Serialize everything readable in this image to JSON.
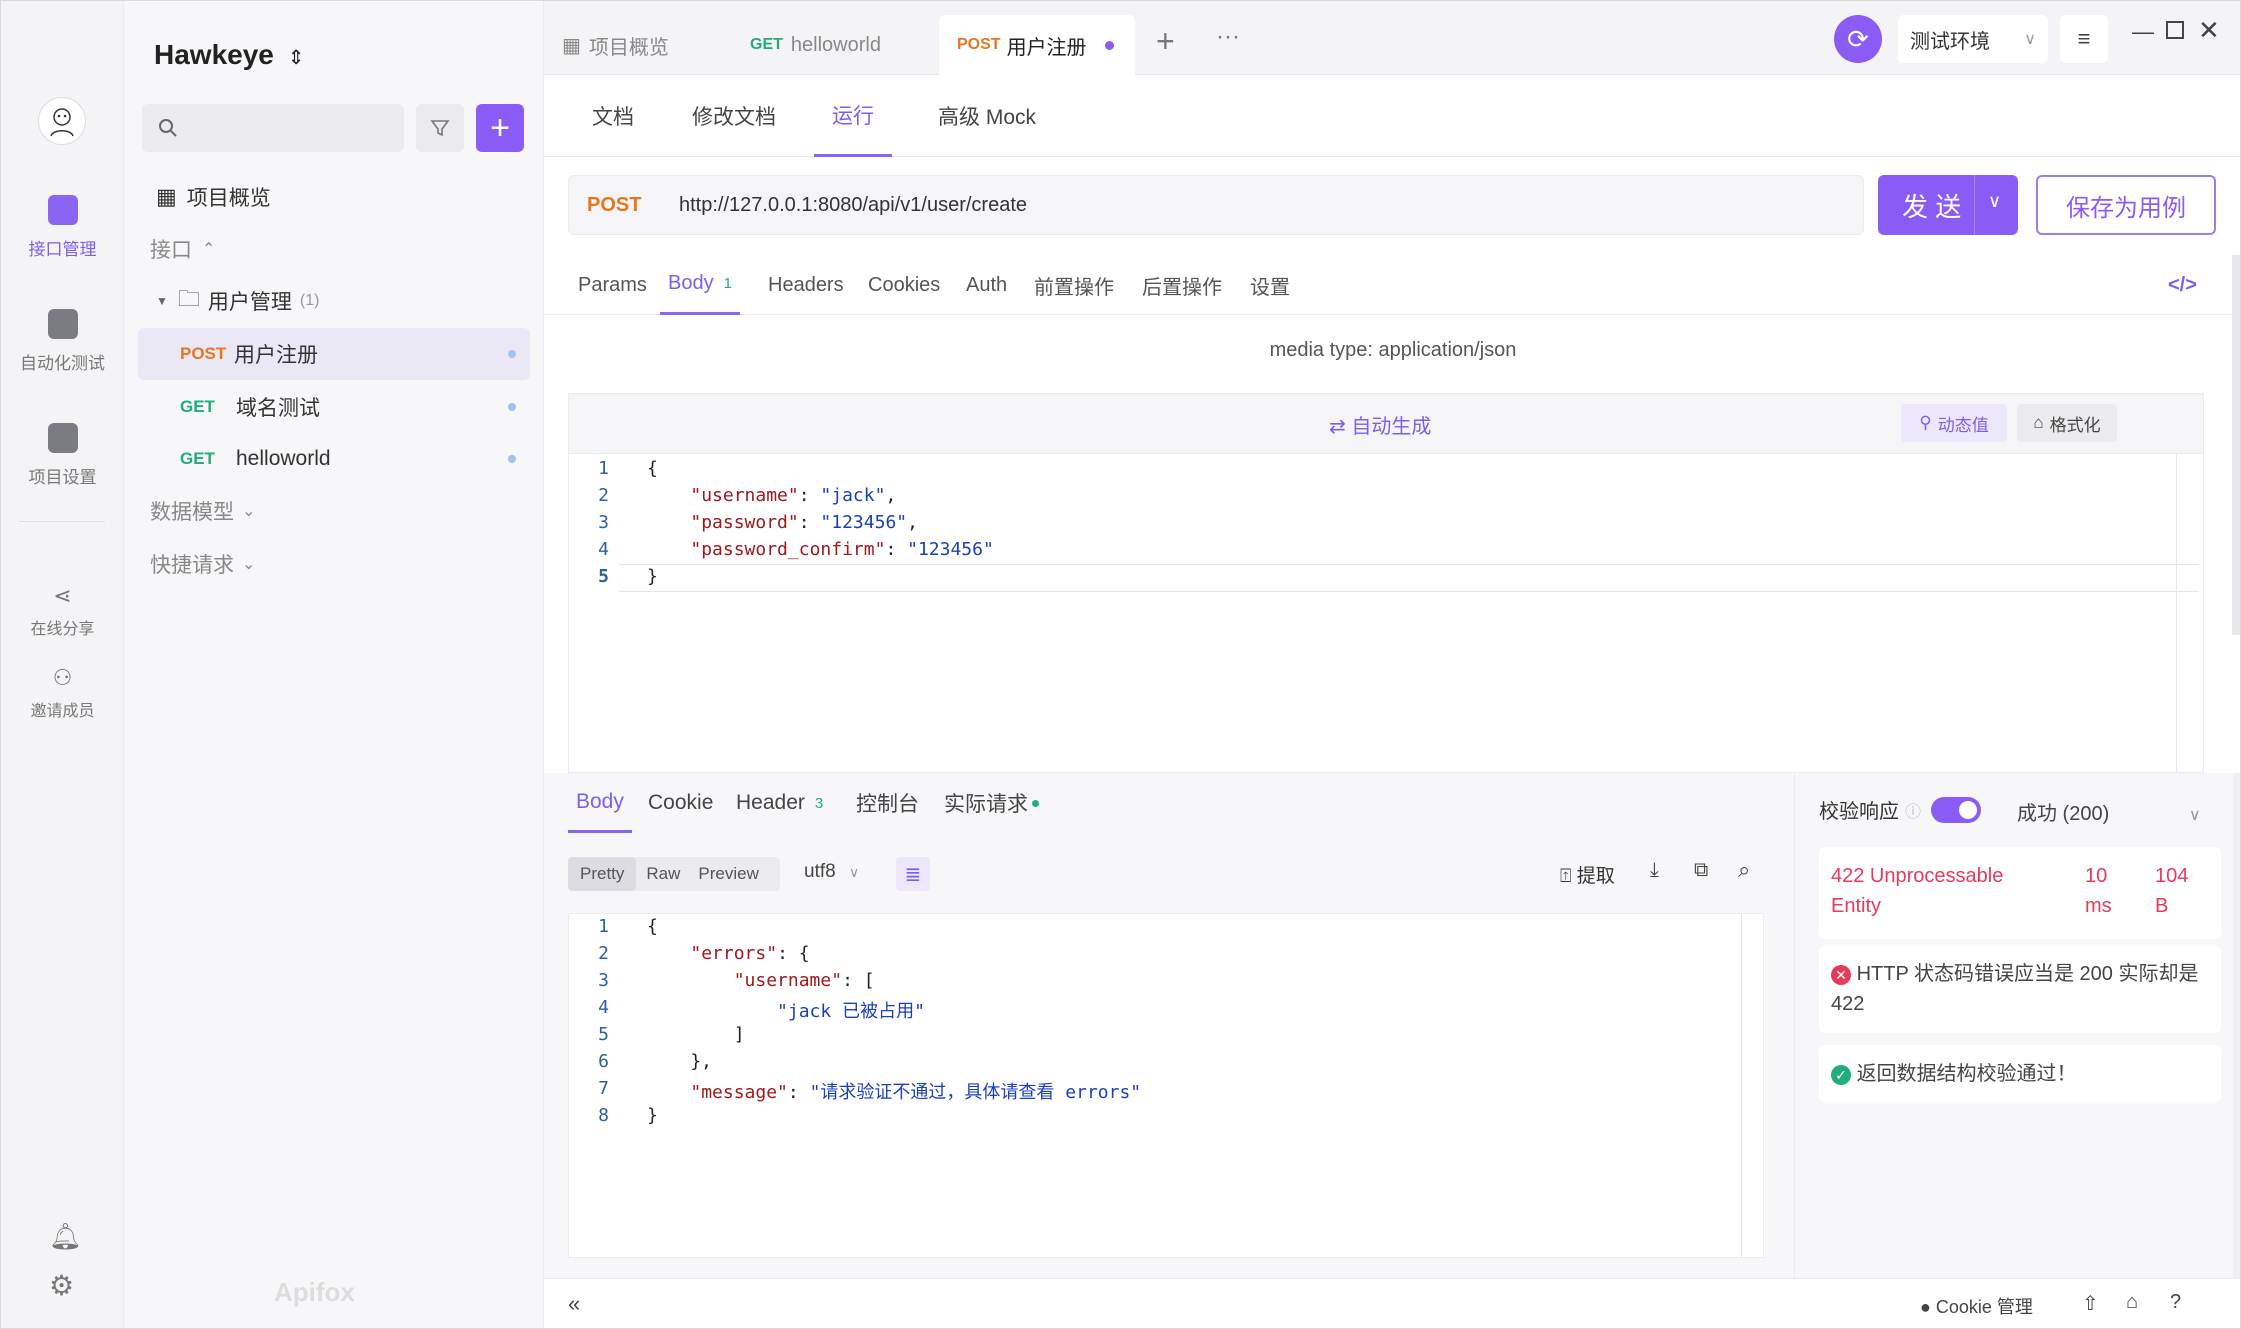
{
  "rail": {
    "items": [
      {
        "label": "接口管理"
      },
      {
        "label": "自动化测试"
      },
      {
        "label": "项目设置"
      },
      {
        "label": "在线分享"
      },
      {
        "label": "邀请成员"
      }
    ]
  },
  "sidebar": {
    "project_name": "Hawkeye",
    "overview": "项目概览",
    "api_section": "接口",
    "folder_name": "用户管理",
    "folder_count": "(1)",
    "items": [
      {
        "method": "POST",
        "name": "用户注册"
      },
      {
        "method": "GET",
        "name": "域名测试"
      },
      {
        "method": "GET",
        "name": "helloworld"
      }
    ],
    "data_models": "数据模型",
    "quick_requests": "快捷请求",
    "brand": "Apifox"
  },
  "tabs": [
    {
      "method": "",
      "label": "项目概览"
    },
    {
      "method": "GET",
      "label": "helloworld"
    },
    {
      "method": "POST",
      "label": "用户注册"
    }
  ],
  "env": {
    "name": "测试环境"
  },
  "subtabs": [
    "文档",
    "修改文档",
    "运行",
    "高级 Mock"
  ],
  "request": {
    "method": "POST",
    "url": "http://127.0.0.1:8080/api/v1/user/create",
    "send_label": "发 送",
    "save_label": "保存为用例"
  },
  "param_tabs": [
    "Params",
    "Body",
    "Headers",
    "Cookies",
    "Auth",
    "前置操作",
    "后置操作",
    "设置"
  ],
  "body_badge": "1",
  "media_type": "media type: application/json",
  "auto_gen": "自动生成",
  "dynamic_value": "动态值",
  "format": "格式化",
  "request_body": [
    "{",
    "    \"username\": \"jack\",",
    "    \"password\": \"123456\",",
    "    \"password_confirm\": \"123456\"",
    "}"
  ],
  "response": {
    "tabs": [
      "Body",
      "Cookie",
      "Header",
      "控制台",
      "实际请求"
    ],
    "header_badge": "3",
    "view_modes": [
      "Pretty",
      "Raw",
      "Preview"
    ],
    "encoding": "utf8",
    "extract": "提取",
    "body": [
      "{",
      "    \"errors\": {",
      "        \"username\": [",
      "            \"jack 已被占用\"",
      "        ]",
      "    },",
      "    \"message\": \"请求验证不通过，具体请查看 errors\"",
      "}"
    ]
  },
  "validation": {
    "label": "校验响应",
    "expected": "成功 (200)",
    "status_line1": "422 Unprocessable",
    "status_line2": "Entity",
    "time_value": "10",
    "time_unit": "ms",
    "size_value": "104",
    "size_unit": "B",
    "error_msg": "HTTP 状态码错误应当是 200 实际却是 422",
    "success_msg": "返回数据结构校验通过！"
  },
  "footer": {
    "cookie_manager": "Cookie 管理"
  },
  "colors": {
    "accent": "#8a5cf5",
    "post": "#e8761e",
    "get": "#1fae7a",
    "error": "#e8395a"
  }
}
